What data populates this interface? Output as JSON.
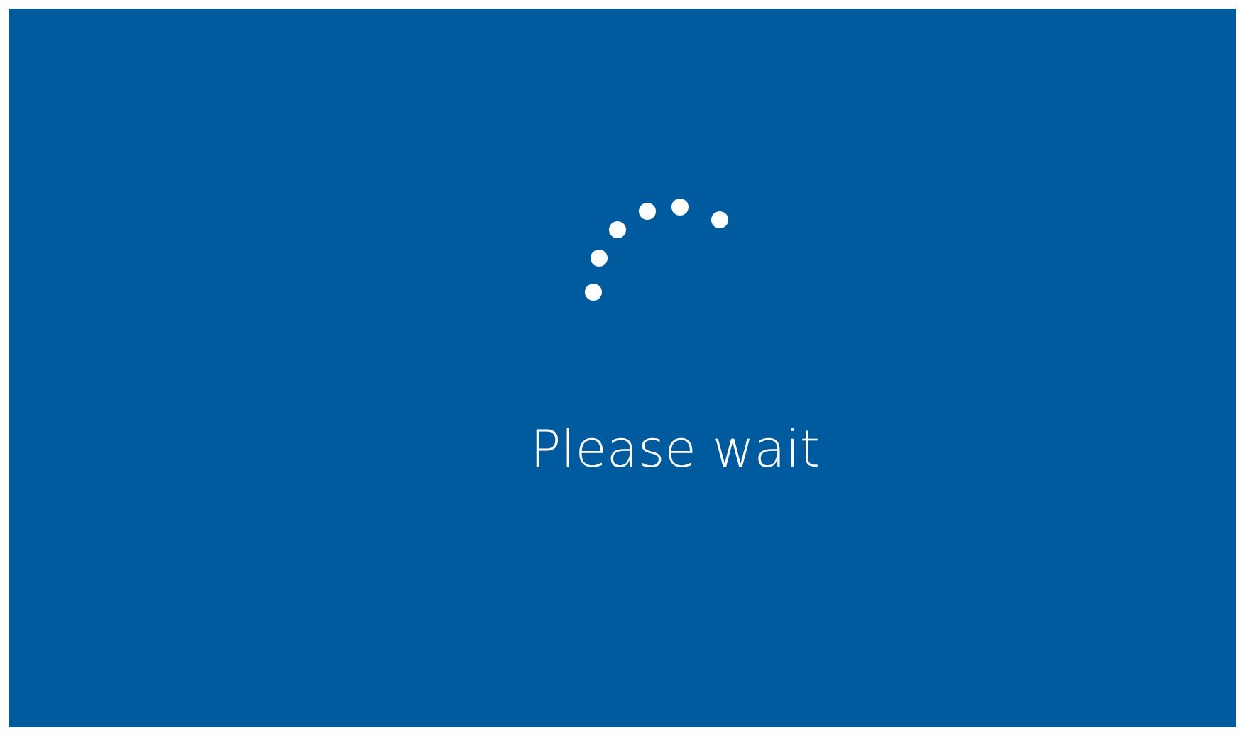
{
  "screen": {
    "message": "Please wait"
  }
}
